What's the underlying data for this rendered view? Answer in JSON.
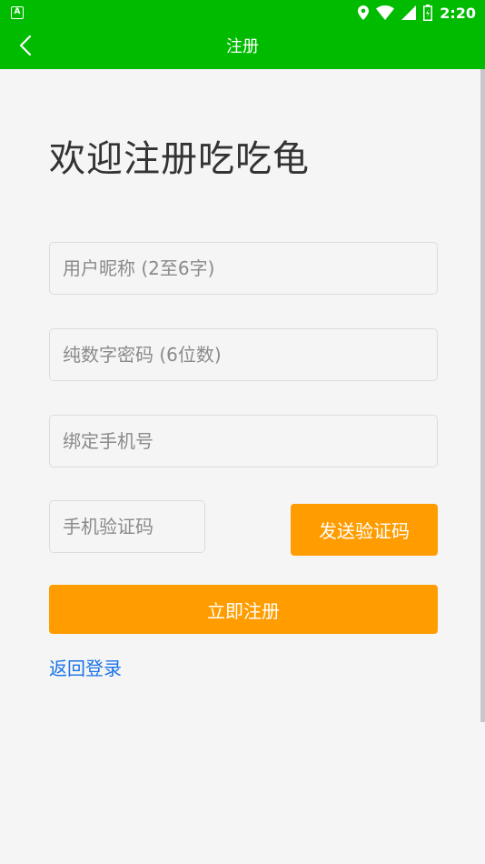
{
  "status_bar": {
    "time": "2:20",
    "left_icon": "a-icon",
    "icons": [
      "location-icon",
      "wifi-icon",
      "signal-icon",
      "battery-icon"
    ]
  },
  "app_bar": {
    "title": "注册",
    "back_icon": "chevron-left-icon"
  },
  "welcome_text": "欢迎注册吃吃龟",
  "form": {
    "nickname_placeholder": "用户昵称 (2至6字)",
    "password_placeholder": "纯数字密码 (6位数)",
    "phone_placeholder": "绑定手机号",
    "code_placeholder": "手机验证码",
    "send_code_label": "发送验证码",
    "register_label": "立即注册",
    "back_to_login_label": "返回登录"
  },
  "colors": {
    "primary_green": "#00bb00",
    "button_orange": "#ff9d00",
    "link_blue": "#1a73e8",
    "background": "#f5f5f5"
  }
}
